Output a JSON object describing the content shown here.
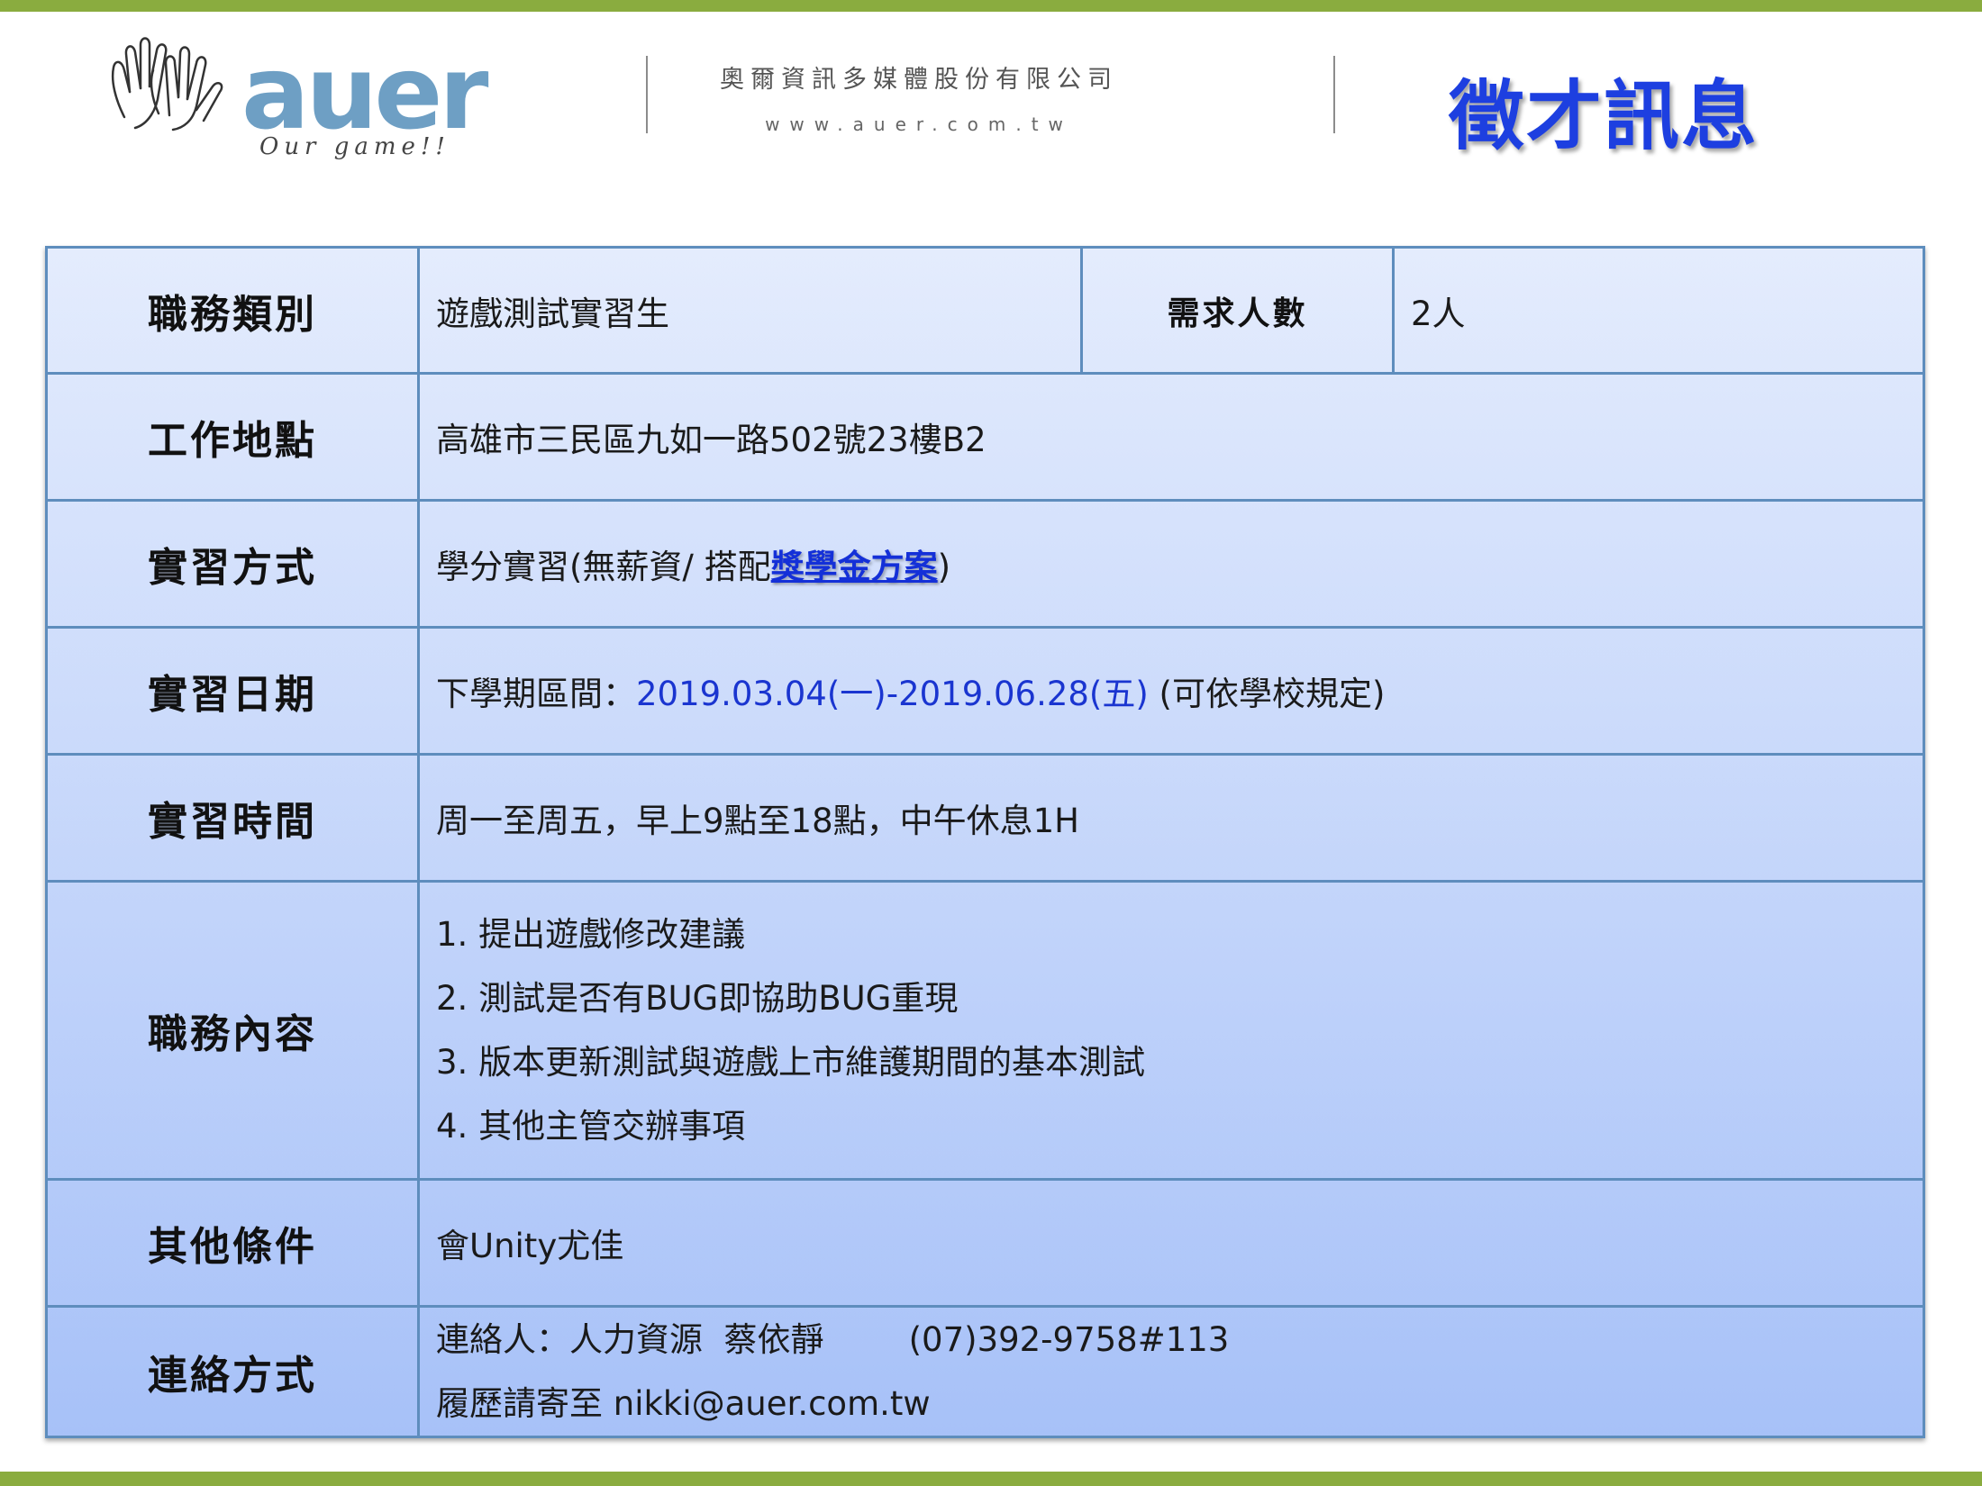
{
  "header": {
    "logo_word": "auer",
    "logo_tagline": "Our game!!",
    "company_name": "奧爾資訊多媒體股份有限公司",
    "website": "www.auer.com.tw",
    "title": "徵才訊息"
  },
  "rows": {
    "category": {
      "label": "職務類別",
      "value": "遊戲測試實習生",
      "headcount_label": "需求人數",
      "headcount_value": "2人"
    },
    "location": {
      "label": "工作地點",
      "value": "高雄市三民區九如一路502號23樓B2"
    },
    "method": {
      "label": "實習方式",
      "prefix": "學分實習(無薪資/ 搭配",
      "link": "獎學金方案",
      "suffix": ")"
    },
    "dates": {
      "label": "實習日期",
      "prefix": "下學期區間：",
      "range": "2019.03.04(一)-2019.06.28(五)",
      "suffix": " (可依學校規定)"
    },
    "hours": {
      "label": "實習時間",
      "value": "周一至周五，早上9點至18點，中午休息1H"
    },
    "duties": {
      "label": "職務內容",
      "items": [
        "1. 提出遊戲修改建議",
        "2. 測試是否有BUG即協助BUG重現",
        "3. 版本更新測試與遊戲上市維護期間的基本測試",
        "4. 其他主管交辦事項"
      ]
    },
    "other": {
      "label": "其他條件",
      "value": "會Unity尤佳"
    },
    "contact": {
      "label": "連絡方式",
      "line1": "連絡人：人力資源  蔡依靜        (07)392-9758#113",
      "line2": "履歷請寄至 nikki@auer.com.tw"
    }
  },
  "colors": {
    "accent_bar": "#8aac3f",
    "title_blue": "#1d3fe0",
    "table_border": "#5e8dbd",
    "link_blue": "#1430d8"
  },
  "icons": [
    "hands-logo-icon"
  ]
}
